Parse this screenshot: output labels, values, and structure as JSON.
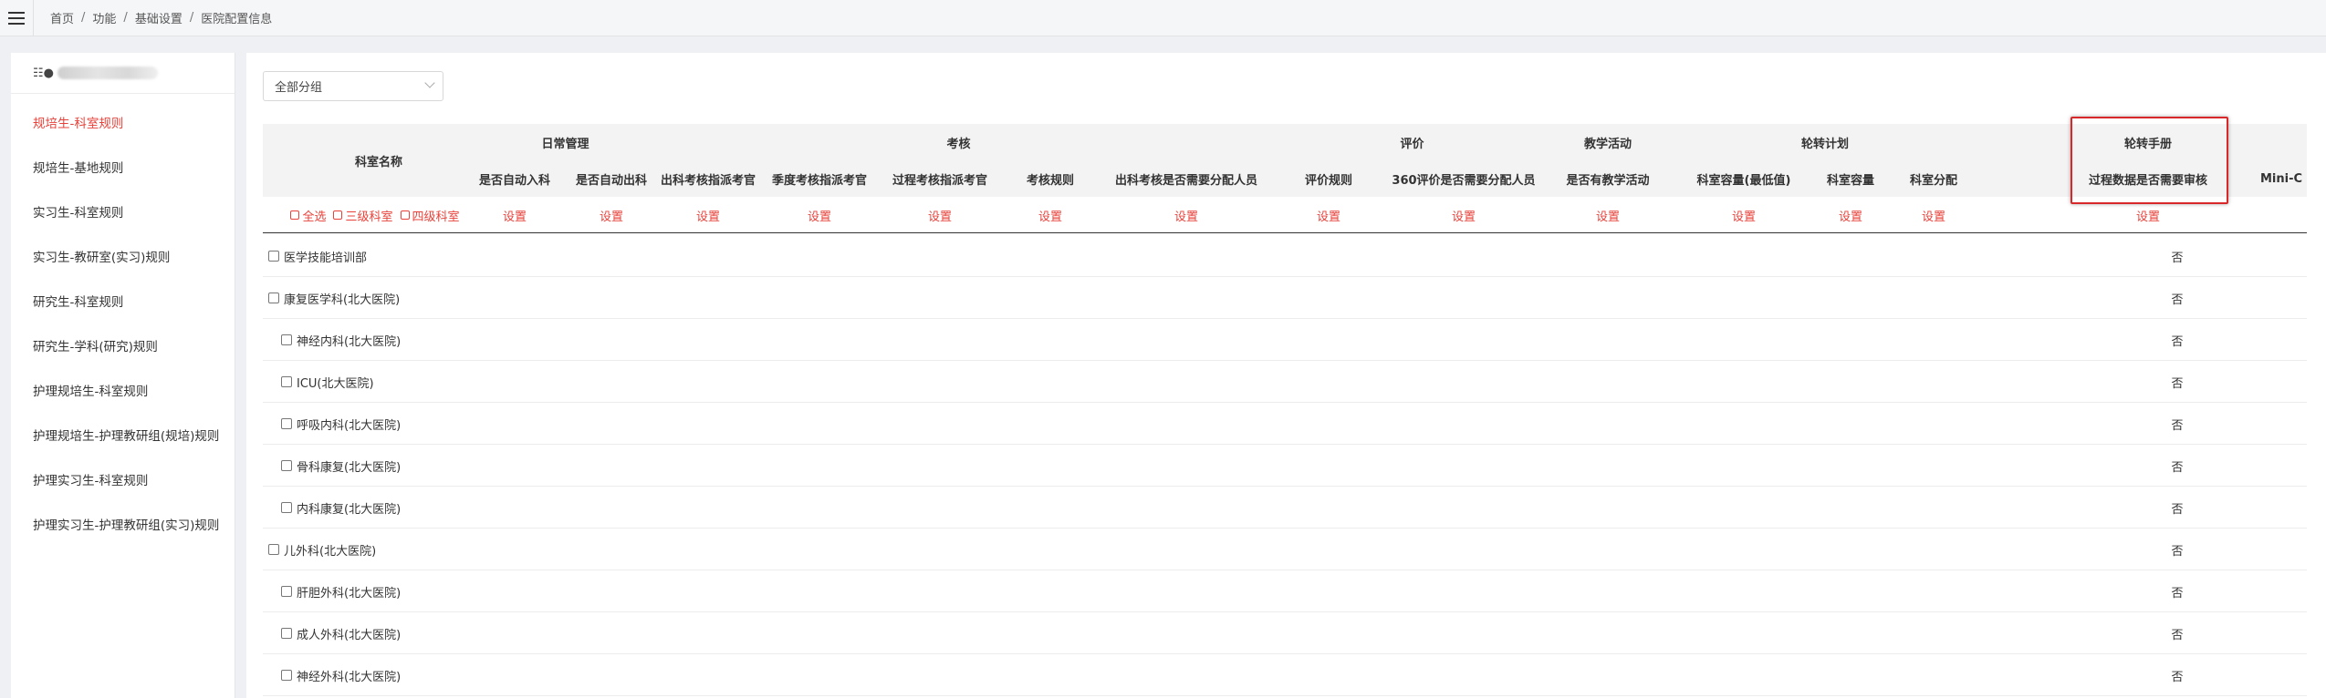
{
  "breadcrumb": [
    "首页",
    "功能",
    "基础设置",
    "医院配置信息"
  ],
  "sidebar": {
    "hospital_icon": "list-icon",
    "items": [
      {
        "label": "规培生-科室规则",
        "active": true
      },
      {
        "label": "规培生-基地规则",
        "active": false
      },
      {
        "label": "实习生-科室规则",
        "active": false
      },
      {
        "label": "实习生-教研室(实习)规则",
        "active": false
      },
      {
        "label": "研究生-科室规则",
        "active": false
      },
      {
        "label": "研究生-学科(研究)规则",
        "active": false
      },
      {
        "label": "护理规培生-科室规则",
        "active": false
      },
      {
        "label": "护理规培生-护理教研组(规培)规则",
        "active": false
      },
      {
        "label": "护理实习生-科室规则",
        "active": false
      },
      {
        "label": "护理实习生-护理教研组(实习)规则",
        "active": false
      }
    ]
  },
  "filter": {
    "group_select": "全部分组"
  },
  "table": {
    "name_header": "科室名称",
    "groups": [
      "日常管理",
      "考核",
      "评价",
      "教学活动",
      "轮转计划",
      "轮转手册"
    ],
    "columns": [
      "是否自动入科",
      "是否自动出科",
      "出科考核指派考官",
      "季度考核指派考官",
      "过程考核指派考官",
      "考核规则",
      "出科考核是否需要分配人员",
      "评价规则",
      "360评价是否需要分配人员",
      "是否有教学活动",
      "科室容量(最低值)",
      "科室容量",
      "科室分配",
      "过程数据是否需要审核",
      "Mini-C"
    ],
    "select_options": [
      "全选",
      "三级科室",
      "四级科室"
    ],
    "set_label": "设置",
    "rows": [
      {
        "name": "医学技能培训部",
        "value": "否"
      },
      {
        "name": "康复医学科(北大医院)",
        "value": "否"
      },
      {
        "name": "神经内科(北大医院)",
        "value": "否"
      },
      {
        "name": "ICU(北大医院)",
        "value": "否"
      },
      {
        "name": "呼吸内科(北大医院)",
        "value": "否"
      },
      {
        "name": "骨科康复(北大医院)",
        "value": "否"
      },
      {
        "name": "内科康复(北大医院)",
        "value": "否"
      },
      {
        "name": "儿外科(北大医院)",
        "value": "否"
      },
      {
        "name": "肝胆外科(北大医院)",
        "value": "否"
      },
      {
        "name": "成人外科(北大医院)",
        "value": "否"
      },
      {
        "name": "神经外科(北大医院)",
        "value": "否"
      }
    ]
  },
  "colors": {
    "accent": "#e8413a",
    "highlight": "#d9282a"
  }
}
